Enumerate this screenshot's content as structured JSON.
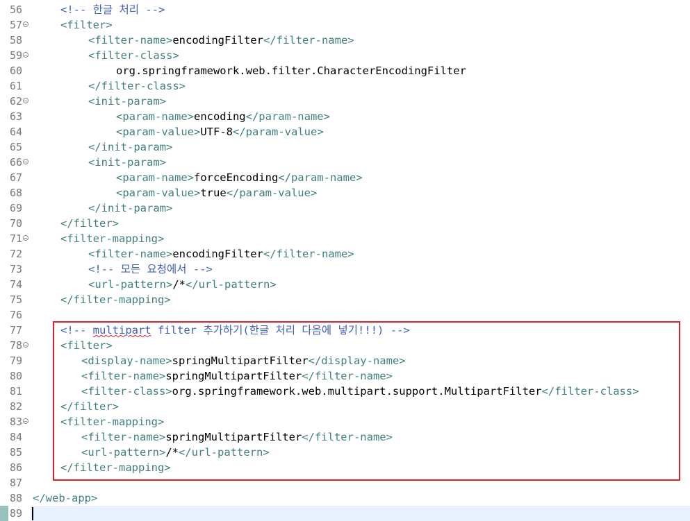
{
  "editor": {
    "lines": [
      {
        "num": "56",
        "fold": false,
        "indent": 40,
        "parts": [
          {
            "t": "cmt",
            "v": "<!-- 한글 처리 -->"
          }
        ]
      },
      {
        "num": "57",
        "fold": true,
        "indent": 40,
        "parts": [
          {
            "t": "tag",
            "v": "<filter>"
          }
        ]
      },
      {
        "num": "58",
        "fold": false,
        "indent": 80,
        "parts": [
          {
            "t": "tag",
            "v": "<filter-name>"
          },
          {
            "t": "txt",
            "v": "encodingFilter"
          },
          {
            "t": "tag",
            "v": "</filter-name>"
          }
        ]
      },
      {
        "num": "59",
        "fold": true,
        "indent": 80,
        "parts": [
          {
            "t": "tag",
            "v": "<filter-class>"
          }
        ]
      },
      {
        "num": "60",
        "fold": false,
        "indent": 120,
        "parts": [
          {
            "t": "txt",
            "v": "org.springframework.web.filter.CharacterEncodingFilter"
          }
        ]
      },
      {
        "num": "61",
        "fold": false,
        "indent": 80,
        "parts": [
          {
            "t": "tag",
            "v": "</filter-class>"
          }
        ]
      },
      {
        "num": "62",
        "fold": true,
        "indent": 80,
        "parts": [
          {
            "t": "tag",
            "v": "<init-param>"
          }
        ]
      },
      {
        "num": "63",
        "fold": false,
        "indent": 120,
        "parts": [
          {
            "t": "tag",
            "v": "<param-name>"
          },
          {
            "t": "txt",
            "v": "encoding"
          },
          {
            "t": "tag",
            "v": "</param-name>"
          }
        ]
      },
      {
        "num": "64",
        "fold": false,
        "indent": 120,
        "parts": [
          {
            "t": "tag",
            "v": "<param-value>"
          },
          {
            "t": "txt",
            "v": "UTF-8"
          },
          {
            "t": "tag",
            "v": "</param-value>"
          }
        ]
      },
      {
        "num": "65",
        "fold": false,
        "indent": 80,
        "parts": [
          {
            "t": "tag",
            "v": "</init-param>"
          }
        ]
      },
      {
        "num": "66",
        "fold": true,
        "indent": 80,
        "parts": [
          {
            "t": "tag",
            "v": "<init-param>"
          }
        ]
      },
      {
        "num": "67",
        "fold": false,
        "indent": 120,
        "parts": [
          {
            "t": "tag",
            "v": "<param-name>"
          },
          {
            "t": "txt",
            "v": "forceEncoding"
          },
          {
            "t": "tag",
            "v": "</param-name>"
          }
        ]
      },
      {
        "num": "68",
        "fold": false,
        "indent": 120,
        "parts": [
          {
            "t": "tag",
            "v": "<param-value>"
          },
          {
            "t": "txt",
            "v": "true"
          },
          {
            "t": "tag",
            "v": "</param-value>"
          }
        ]
      },
      {
        "num": "69",
        "fold": false,
        "indent": 80,
        "parts": [
          {
            "t": "tag",
            "v": "</init-param>"
          }
        ]
      },
      {
        "num": "70",
        "fold": false,
        "indent": 40,
        "parts": [
          {
            "t": "tag",
            "v": "</filter>"
          }
        ]
      },
      {
        "num": "71",
        "fold": true,
        "indent": 40,
        "parts": [
          {
            "t": "tag",
            "v": "<filter-mapping>"
          }
        ]
      },
      {
        "num": "72",
        "fold": false,
        "indent": 80,
        "parts": [
          {
            "t": "tag",
            "v": "<filter-name>"
          },
          {
            "t": "txt",
            "v": "encodingFilter"
          },
          {
            "t": "tag",
            "v": "</filter-name>"
          }
        ]
      },
      {
        "num": "73",
        "fold": false,
        "indent": 80,
        "parts": [
          {
            "t": "cmt",
            "v": "<!-- 모든 요청에서 -->"
          }
        ]
      },
      {
        "num": "74",
        "fold": false,
        "indent": 80,
        "parts": [
          {
            "t": "tag",
            "v": "<url-pattern>"
          },
          {
            "t": "txt",
            "v": "/*"
          },
          {
            "t": "tag",
            "v": "</url-pattern>"
          }
        ]
      },
      {
        "num": "75",
        "fold": false,
        "indent": 40,
        "parts": [
          {
            "t": "tag",
            "v": "</filter-mapping>"
          }
        ]
      },
      {
        "num": "76",
        "fold": false,
        "indent": 40,
        "parts": []
      },
      {
        "num": "77",
        "fold": false,
        "indent": 40,
        "parts": [
          {
            "t": "cmt",
            "v": "<!-- "
          },
          {
            "t": "cmt sq",
            "v": "multipart"
          },
          {
            "t": "cmt",
            "v": " filter 추가하기(한글 처리 다음에 넣기!!!) -->"
          }
        ]
      },
      {
        "num": "78",
        "fold": true,
        "indent": 40,
        "parts": [
          {
            "t": "tag",
            "v": "<filter>"
          }
        ]
      },
      {
        "num": "79",
        "fold": false,
        "indent": 70,
        "parts": [
          {
            "t": "tag",
            "v": "<display-name>"
          },
          {
            "t": "txt",
            "v": "springMultipartFilter"
          },
          {
            "t": "tag",
            "v": "</display-name>"
          }
        ]
      },
      {
        "num": "80",
        "fold": false,
        "indent": 70,
        "parts": [
          {
            "t": "tag",
            "v": "<filter-name>"
          },
          {
            "t": "txt",
            "v": "springMultipartFilter"
          },
          {
            "t": "tag",
            "v": "</filter-name>"
          }
        ]
      },
      {
        "num": "81",
        "fold": false,
        "indent": 70,
        "parts": [
          {
            "t": "tag",
            "v": "<filter-class>"
          },
          {
            "t": "txt",
            "v": "org.springframework.web.multipart.support.MultipartFilter"
          },
          {
            "t": "tag",
            "v": "</filter-class>"
          }
        ]
      },
      {
        "num": "82",
        "fold": false,
        "indent": 40,
        "parts": [
          {
            "t": "tag",
            "v": "</filter>"
          }
        ]
      },
      {
        "num": "83",
        "fold": true,
        "indent": 40,
        "parts": [
          {
            "t": "tag",
            "v": "<filter-mapping>"
          }
        ]
      },
      {
        "num": "84",
        "fold": false,
        "indent": 70,
        "parts": [
          {
            "t": "tag",
            "v": "<filter-name>"
          },
          {
            "t": "txt",
            "v": "springMultipartFilter"
          },
          {
            "t": "tag",
            "v": "</filter-name>"
          }
        ]
      },
      {
        "num": "85",
        "fold": false,
        "indent": 70,
        "parts": [
          {
            "t": "tag",
            "v": "<url-pattern>"
          },
          {
            "t": "txt",
            "v": "/*"
          },
          {
            "t": "tag",
            "v": "</url-pattern>"
          }
        ]
      },
      {
        "num": "86",
        "fold": false,
        "indent": 40,
        "parts": [
          {
            "t": "tag",
            "v": "</filter-mapping>"
          }
        ]
      },
      {
        "num": "87",
        "fold": false,
        "indent": 40,
        "parts": []
      },
      {
        "num": "88",
        "fold": false,
        "indent": 0,
        "parts": [
          {
            "t": "tag",
            "v": "</web-app>"
          }
        ]
      },
      {
        "num": "89",
        "fold": false,
        "indent": 0,
        "parts": []
      }
    ]
  },
  "colors": {
    "tag": "#3f7f7f",
    "comment": "#3f5fbf",
    "text": "#000000",
    "highlight_border": "#d9222a",
    "current_line": "#e8f2fe"
  },
  "icons": {
    "fold": "fold-collapse-icon"
  }
}
